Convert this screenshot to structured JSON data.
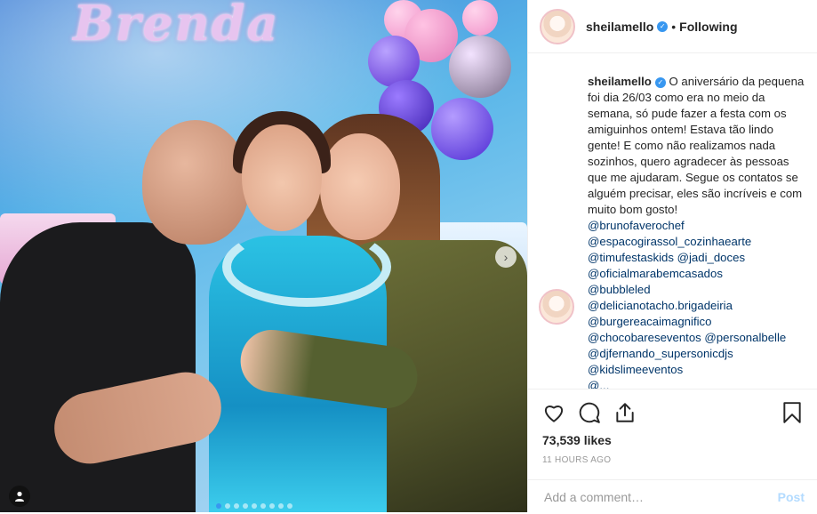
{
  "photo": {
    "banner_text": "Brenda",
    "carousel_dots": 9,
    "active_dot_index": 0
  },
  "header": {
    "username": "sheilamello",
    "separator": "•",
    "follow_status": "Following"
  },
  "caption": {
    "username": "sheilamello",
    "text": "O aniversário da pequena foi dia 26/03 como era no meio da semana, só pude fazer a festa com os amiguinhos ontem! Estava tão lindo gente! E como não realizamos nada sozinhos, quero agradecer às pessoas que me ajudaram. Segue os contatos se alguém precisar, eles são incríveis e com muito bom gosto!",
    "mentions": [
      "@brunofaverochef",
      "@espacogirassol_cozinhaearte",
      "@timufestaskids @jadi_doces",
      "@oficialmarabemcasados",
      "@bubbleled",
      "@delicianotacho.brigadeiria",
      "@burgereacaimagnifico",
      "@chocobareseventos @personalbelle",
      "@djfernando_supersonicdjs",
      "@kidslimeeventos",
      "@..."
    ]
  },
  "actions": {
    "likes": "73,539 likes",
    "timestamp": "11 HOURS AGO",
    "comment_placeholder": "Add a comment…",
    "post_label": "Post"
  },
  "colors": {
    "link": "#003569",
    "verified": "#3897f0",
    "post_disabled": "#b3dbff"
  }
}
